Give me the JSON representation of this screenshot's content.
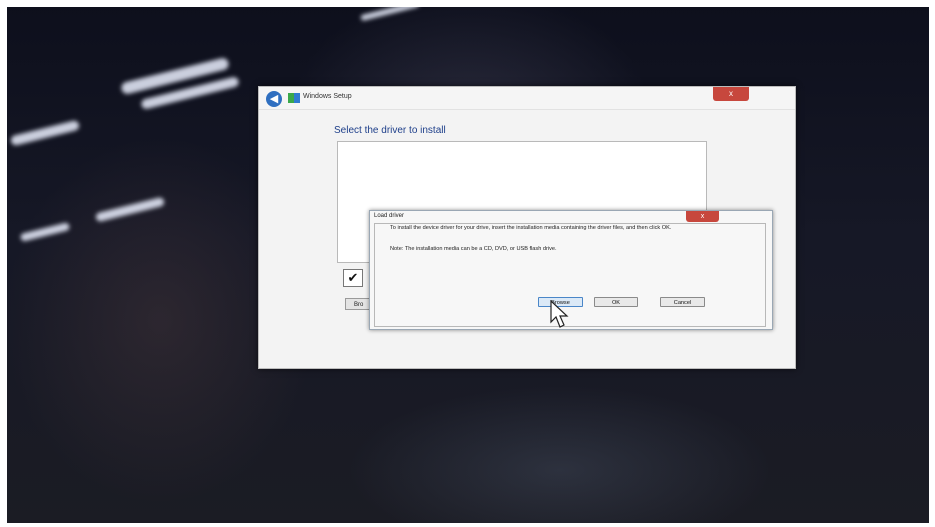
{
  "setup_window": {
    "title": "Windows Setup",
    "heading": "Select the driver to install",
    "close_label": "x",
    "browse_stub_label": "Bro",
    "checkbox_mark": "✔",
    "back_icon": "back-arrow-icon",
    "app_icon": "windows-setup-icon"
  },
  "load_driver_dialog": {
    "title": "Load driver",
    "close_label": "x",
    "message": "To install the device driver for your drive, insert the installation media containing the driver files, and then click OK.",
    "note": "Note: The installation media can be a CD, DVD, or USB flash drive.",
    "buttons": {
      "browse": "Browse",
      "ok": "OK",
      "cancel": "Cancel"
    }
  },
  "colors": {
    "close_button": "#c7473d",
    "heading_text": "#1e3f8a",
    "focus_button": "#dbe9f7"
  }
}
